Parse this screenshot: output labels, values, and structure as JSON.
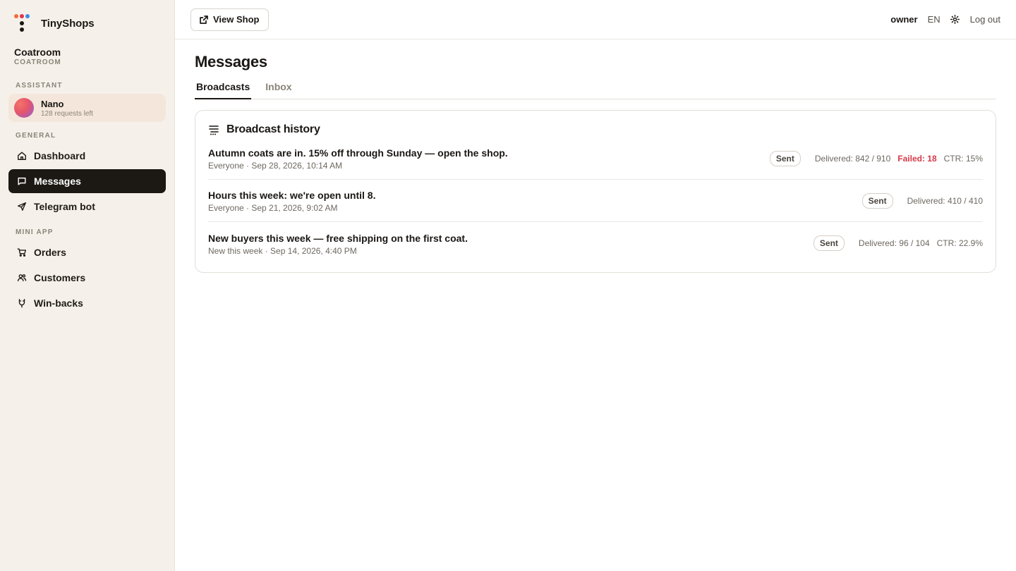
{
  "brand": {
    "name": "TinyShops",
    "logo_colors": [
      "#f26b3a",
      "#e2344d",
      "#3c8ee6",
      "#1a1714"
    ]
  },
  "shop": {
    "name": "Coatroom",
    "code": "COATROOM"
  },
  "sidebar": {
    "assistant_label": "ASSISTANT",
    "assistant": {
      "name": "Nano",
      "sub": "128 requests left"
    },
    "general_label": "GENERAL",
    "general_items": [
      {
        "label": "Dashboard",
        "icon": "home-icon"
      },
      {
        "label": "Messages",
        "icon": "message-icon",
        "active": true
      },
      {
        "label": "Telegram bot",
        "icon": "send-icon"
      }
    ],
    "miniapp_label": "MINI APP",
    "miniapp_items": [
      {
        "label": "Orders",
        "icon": "cart-icon"
      },
      {
        "label": "Customers",
        "icon": "users-icon"
      },
      {
        "label": "Win-backs",
        "icon": "magnet-icon"
      }
    ]
  },
  "topbar": {
    "view_shop": "View Shop",
    "user": "owner",
    "lang": "EN",
    "logout": "Log out"
  },
  "page": {
    "title": "Messages",
    "tabs": [
      {
        "label": "Broadcasts",
        "active": true
      },
      {
        "label": "Inbox"
      }
    ]
  },
  "broadcast_history": {
    "title": "Broadcast history",
    "items": [
      {
        "message": "Autumn coats are in. 15% off through Sunday — open the shop.",
        "meta": "Everyone · Sep 28, 2026, 10:14 AM",
        "status": "Sent",
        "delivered": "Delivered: 842 / 910",
        "failed": "Failed: 18",
        "ctr": "CTR: 15%"
      },
      {
        "message": "Hours this week: we're open until 8.",
        "meta": "Everyone · Sep 21, 2026, 9:02 AM",
        "status": "Sent",
        "delivered": "Delivered: 410 / 410",
        "failed": "",
        "ctr": ""
      },
      {
        "message": "New buyers this week — free shipping on the first coat.",
        "meta": "New this week · Sep 14, 2026, 4:40 PM",
        "status": "Sent",
        "delivered": "Delivered: 96 / 104",
        "failed": "",
        "ctr": "CTR: 22.9%"
      }
    ]
  },
  "colors": {
    "accent_dark": "#1c1814",
    "failed": "#d63a4a",
    "sidebar_bg": "#f5f1ea",
    "assistant_bg": "#f4e6da"
  }
}
